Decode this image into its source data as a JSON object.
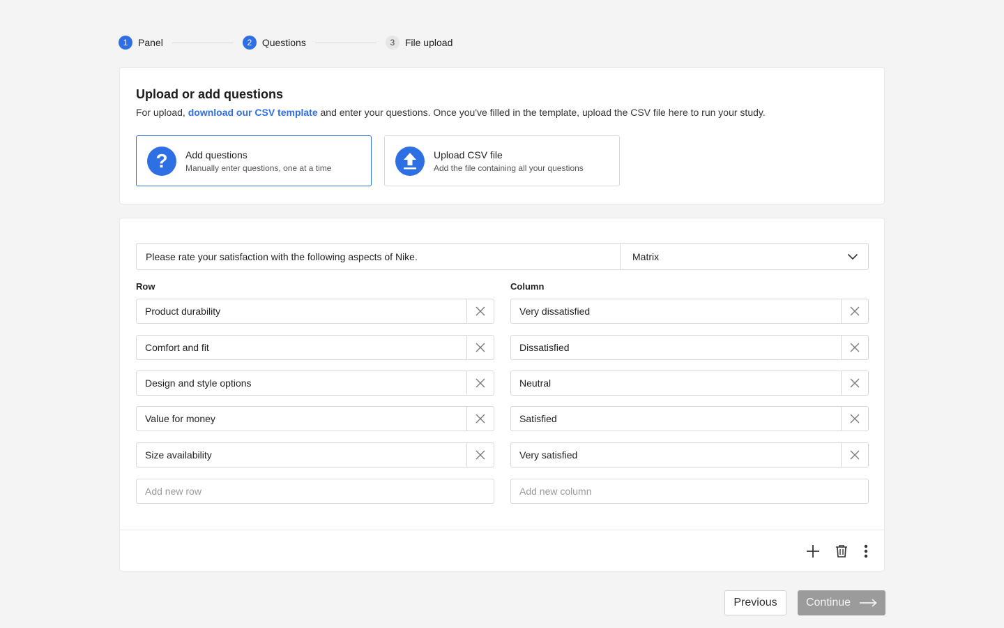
{
  "stepper": [
    {
      "num": "1",
      "label": "Panel",
      "state": "active"
    },
    {
      "num": "2",
      "label": "Questions",
      "state": "active"
    },
    {
      "num": "3",
      "label": "File upload",
      "state": "inactive"
    }
  ],
  "upload": {
    "title": "Upload or add questions",
    "desc_prefix": "For upload, ",
    "desc_link": "download our CSV template",
    "desc_suffix": " and enter your questions. Once you've filled in the template, upload the CSV file here to run your study.",
    "options": [
      {
        "title": "Add questions",
        "subtitle": "Manually enter questions, one at a time",
        "icon": "question-icon",
        "selected": true
      },
      {
        "title": "Upload CSV file",
        "subtitle": "Add the file containing all your questions",
        "icon": "upload-icon",
        "selected": false
      }
    ]
  },
  "question": {
    "text": "Please rate your satisfaction with the following aspects of Nike.",
    "type": "Matrix",
    "row_header": "Row",
    "column_header": "Column",
    "rows": [
      "Product durability",
      "Comfort and fit",
      "Design and style options",
      "Value for money",
      "Size availability"
    ],
    "columns": [
      "Very dissatisfied",
      "Dissatisfied",
      "Neutral",
      "Satisfied",
      "Very satisfied"
    ],
    "add_row_placeholder": "Add new row",
    "add_column_placeholder": "Add new column"
  },
  "footer": {
    "previous_label": "Previous",
    "continue_label": "Continue"
  },
  "colors": {
    "accent": "#2f6fe4",
    "disabled_button": "#9b9b9b"
  }
}
